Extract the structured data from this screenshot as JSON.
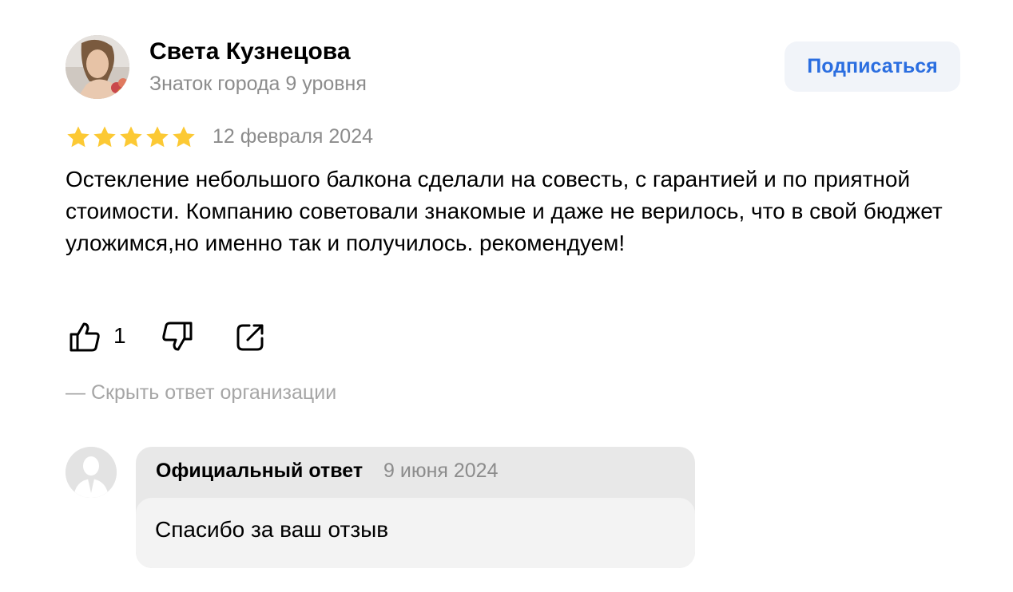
{
  "author": {
    "name": "Света Кузнецова",
    "level": "Знаток города 9 уровня",
    "subscribe_label": "Подписаться"
  },
  "review": {
    "rating": 5,
    "rating_max": 5,
    "date": "12 февраля 2024",
    "text": "Остекление небольшого балкона сделали на совесть, с гарантией и по приятной стоимости. Компанию советовали знакомые и даже не верилось, что в свой бюджет уложимся,но именно так и получилось. рекомендуем!",
    "likes": "1",
    "icons": {
      "like": "thumbs-up-icon",
      "dislike": "thumbs-down-icon",
      "share": "share-icon"
    }
  },
  "reply_toggle": {
    "label": "— Скрыть ответ организации"
  },
  "org_reply": {
    "label": "Официальный ответ",
    "date": "9 июня 2024",
    "text": "Спасибо за ваш отзыв"
  },
  "colors": {
    "star": "#fcc934",
    "accent": "#2b6ee0",
    "muted": "#8c8c8c"
  }
}
